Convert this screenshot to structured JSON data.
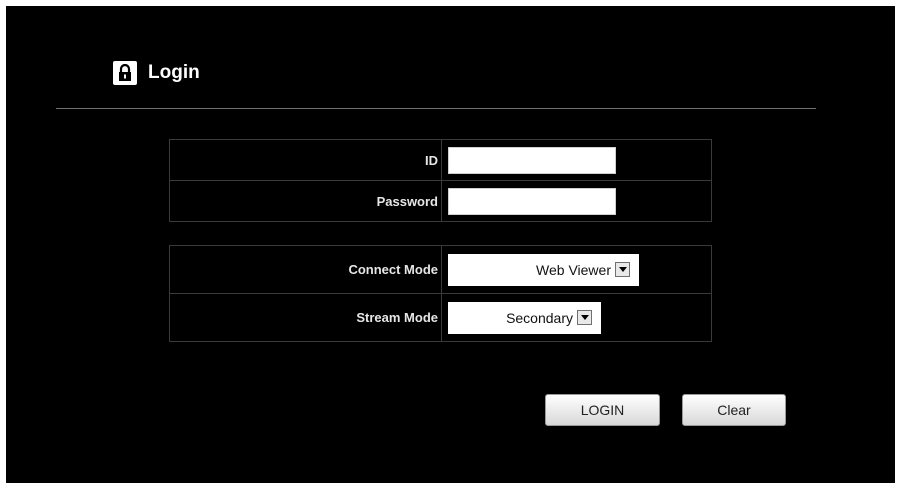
{
  "header": {
    "title": "Login",
    "icon": "lock-icon"
  },
  "credentials": {
    "id_label": "ID",
    "id_value": "",
    "password_label": "Password",
    "password_value": ""
  },
  "modes": {
    "connect_label": "Connect Mode",
    "connect_selected": "Web Viewer",
    "stream_label": "Stream Mode",
    "stream_selected": "Secondary"
  },
  "buttons": {
    "login": "LOGIN",
    "clear": "Clear"
  },
  "colors": {
    "background": "#000000",
    "text": "#ffffff",
    "border": "#3a3a3a"
  }
}
